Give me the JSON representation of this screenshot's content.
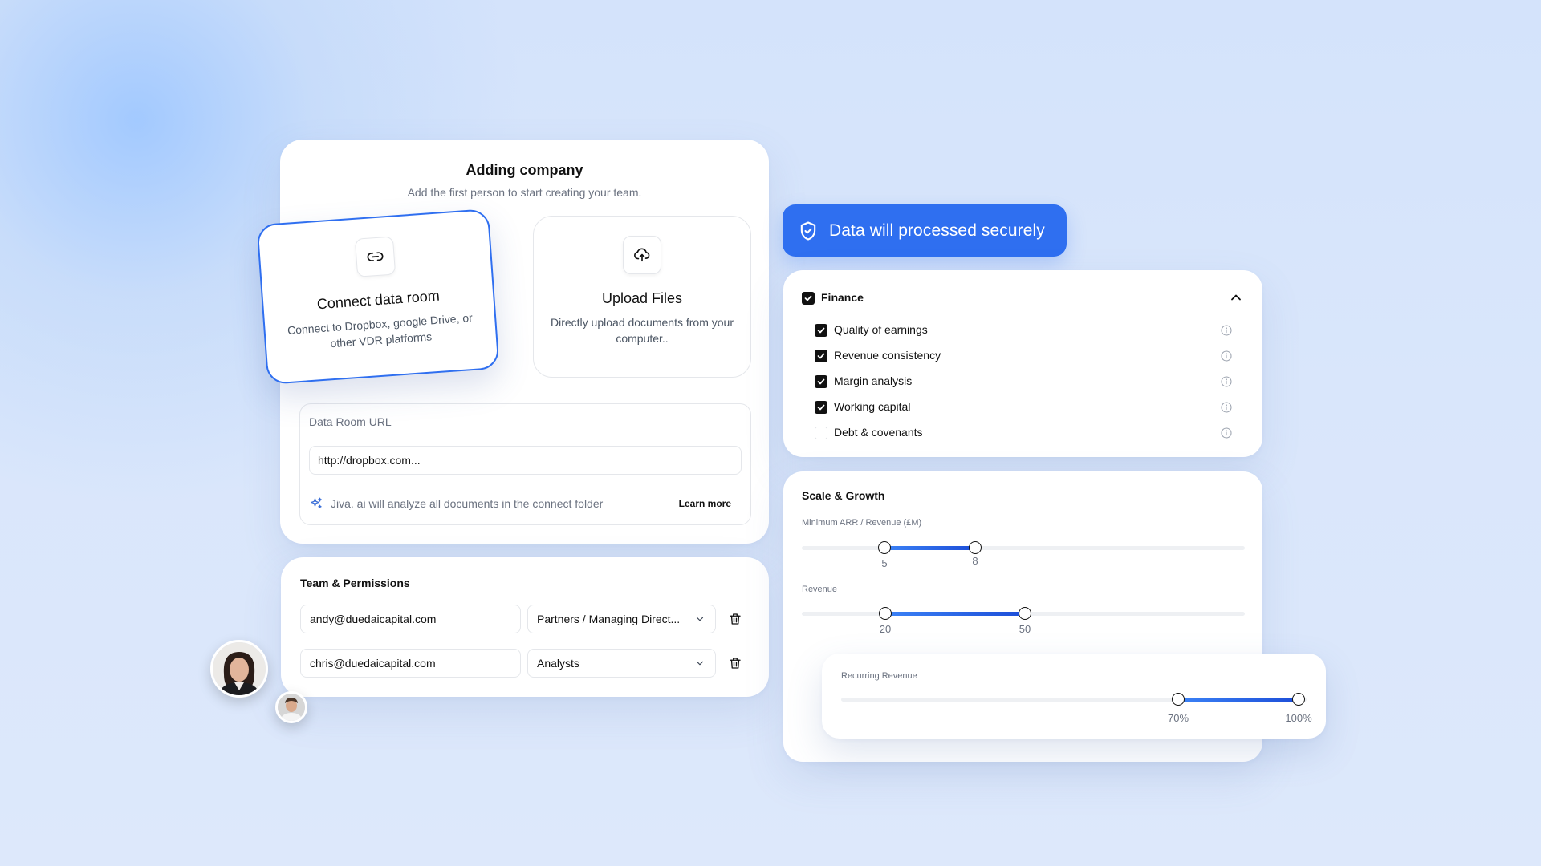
{
  "add_company": {
    "title": "Adding company",
    "subtitle": "Add the first person to start creating your team.",
    "connect": {
      "title": "Connect data room",
      "description": "Connect to Dropbox, google Drive, or other VDR platforms",
      "icon": "link-icon"
    },
    "upload": {
      "title": "Upload Files",
      "description": "Directly upload documents from your computer..",
      "icon": "cloud-upload-icon"
    },
    "data_room": {
      "label": "Data Room URL",
      "value": "http://dropbox.com...",
      "ai_note": "Jiva. ai will analyze all documents in the connect folder",
      "learn_more": "Learn more"
    }
  },
  "team": {
    "title": "Team & Permissions",
    "members": [
      {
        "email": "andy@duedaicapital.com",
        "role": "Partners / Managing Direct..."
      },
      {
        "email": "chris@duedaicapital.com",
        "role": "Analysts"
      }
    ]
  },
  "secure_banner": {
    "text": "Data will processed securely",
    "color": "#2f6ff0"
  },
  "finance": {
    "title": "Finance",
    "checked": true,
    "items": [
      {
        "label": "Quality of earnings",
        "checked": true
      },
      {
        "label": "Revenue consistency",
        "checked": true
      },
      {
        "label": "Margin analysis",
        "checked": true
      },
      {
        "label": "Working capital",
        "checked": true
      },
      {
        "label": "Debt & covenants",
        "checked": false
      }
    ]
  },
  "scale": {
    "title": "Scale & Growth",
    "arr": {
      "label": "Minimum ARR / Revenue (£M)",
      "min": "5",
      "max": "8"
    },
    "revenue": {
      "label": "Revenue",
      "min": "20",
      "max": "50"
    },
    "recurring": {
      "label": "Recurring Revenue",
      "min": "70%",
      "max": "100%"
    }
  }
}
